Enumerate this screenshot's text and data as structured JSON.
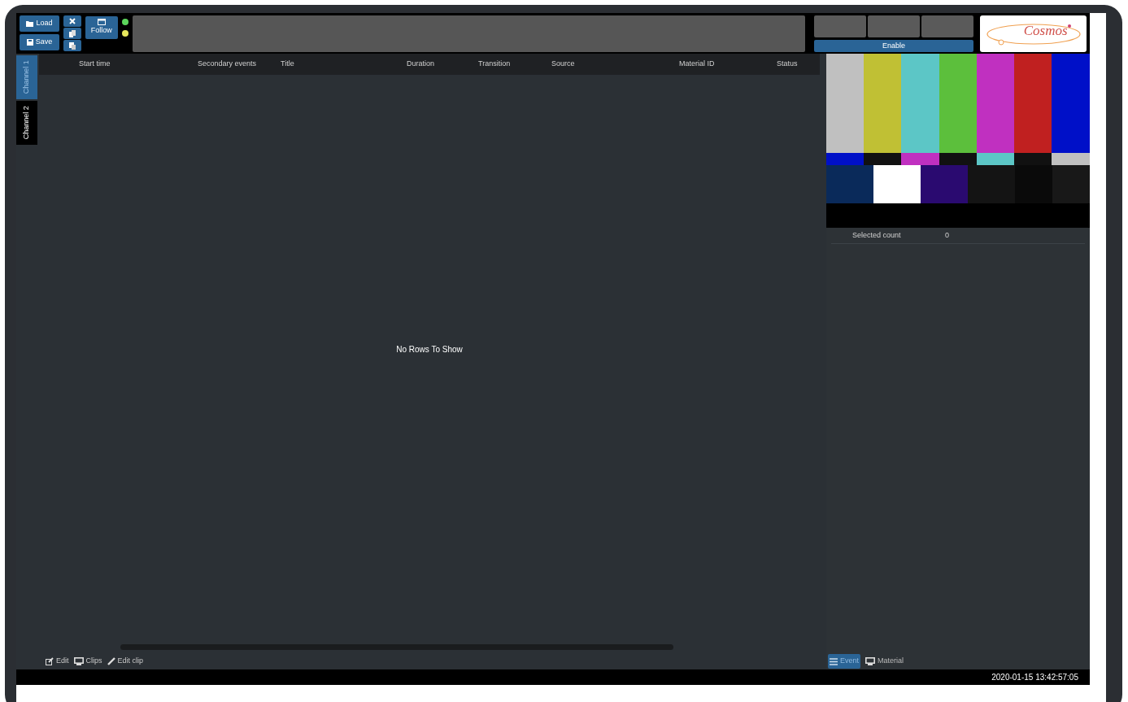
{
  "toolbar": {
    "load": "Load",
    "save": "Save",
    "follow": "Follow"
  },
  "indicators": [
    {
      "color": "#5cd65c"
    },
    {
      "color": "#e6e65c"
    }
  ],
  "right_controls": {
    "enable": "Enable",
    "logo": "Cosmos"
  },
  "channel_tabs": [
    {
      "label": "Channel 1",
      "selected": true
    },
    {
      "label": "Channel 2",
      "selected": false
    }
  ],
  "table": {
    "columns": [
      "Start time",
      "Secondary events",
      "Title",
      "Duration",
      "Transition",
      "Source",
      "Material ID",
      "Status"
    ],
    "empty_message": "No Rows To Show"
  },
  "bottom_toolbar": [
    {
      "kind": "edit",
      "label": "Edit"
    },
    {
      "kind": "clips",
      "label": "Clips"
    },
    {
      "kind": "editclip",
      "label": "Edit clip"
    }
  ],
  "properties": [
    {
      "label": "Selected count",
      "value": "0"
    }
  ],
  "panel_tabs": [
    {
      "kind": "event",
      "label": "Event",
      "selected": true
    },
    {
      "kind": "material",
      "label": "Material",
      "selected": false
    }
  ],
  "status_bar": {
    "datetime": "2020-01-15 13:42:57:05"
  }
}
